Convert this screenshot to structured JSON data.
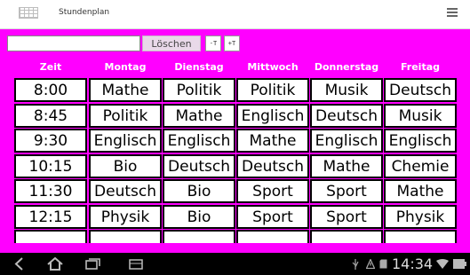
{
  "app": {
    "title": "Stundenplan"
  },
  "toolbar": {
    "search_value": "",
    "clear_label": "Löschen",
    "font_smaller_label": "-T",
    "font_larger_label": "+T"
  },
  "schedule": {
    "columns": [
      "Zeit",
      "Montag",
      "Dienstag",
      "Mittwoch",
      "Donnerstag",
      "Freitag"
    ],
    "rows": [
      [
        "8:00",
        "Mathe",
        "Politik",
        "Politik",
        "Musik",
        "Deutsch"
      ],
      [
        "8:45",
        "Politik",
        "Mathe",
        "Englisch",
        "Deutsch",
        "Musik"
      ],
      [
        "9:30",
        "Englisch",
        "Englisch",
        "Mathe",
        "Englisch",
        "Englisch"
      ],
      [
        "10:15",
        "Bio",
        "Deutsch",
        "Deutsch",
        "Mathe",
        "Chemie"
      ],
      [
        "11:30",
        "Deutsch",
        "Bio",
        "Sport",
        "Sport",
        "Mathe"
      ],
      [
        "12:15",
        "Physik",
        "Bio",
        "Sport",
        "Sport",
        "Physik"
      ],
      [
        "",
        "",
        "",
        "",
        "",
        ""
      ]
    ]
  },
  "system_bar": {
    "time": "14:34"
  },
  "icons": {
    "app": "calendar-grid-icon",
    "overflow": "overflow-menu-icon",
    "back": "back-icon",
    "home": "home-icon",
    "recent": "recent-apps-icon",
    "usb": "usb-icon",
    "warning": "warning-icon",
    "sdcard": "sd-card-icon",
    "wifi": "wifi-icon",
    "battery": "battery-icon"
  },
  "colors": {
    "background": "#ff00ff",
    "cell": "#ffffff",
    "cell_border": "#000000",
    "header_text": "#ffffff"
  }
}
